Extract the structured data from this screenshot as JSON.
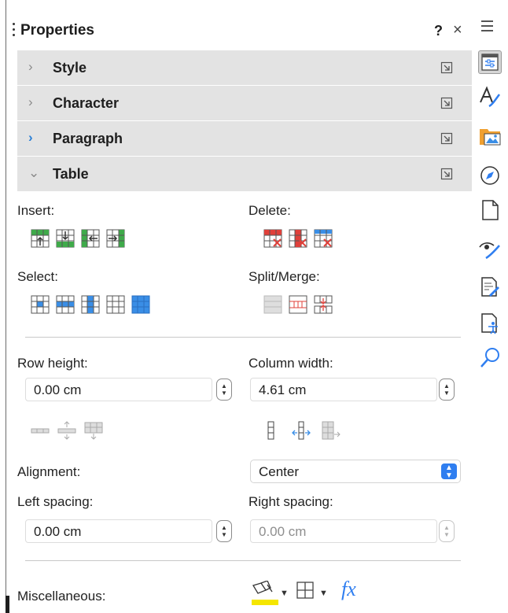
{
  "window": {
    "title": "Properties",
    "help_label": "?",
    "close_label": "×"
  },
  "sections": [
    {
      "label": "Style",
      "state": "collapsed"
    },
    {
      "label": "Character",
      "state": "collapsed"
    },
    {
      "label": "Paragraph",
      "state": "collapsed-active"
    },
    {
      "label": "Table",
      "state": "expanded"
    }
  ],
  "table": {
    "insert_label": "Insert:",
    "delete_label": "Delete:",
    "select_label": "Select:",
    "split_merge_label": "Split/Merge:",
    "insert_icons": [
      "insert-rows-above-icon",
      "insert-rows-below-icon",
      "insert-columns-before-icon",
      "insert-columns-after-icon"
    ],
    "delete_icons": [
      "delete-rows-icon",
      "delete-columns-icon",
      "delete-table-icon"
    ],
    "select_icons": [
      "select-cell-icon",
      "select-row-icon",
      "select-column-icon",
      "select-table-plain-icon",
      "select-table-icon"
    ],
    "split_merge_icons": [
      "merge-cells-icon",
      "split-cells-icon",
      "split-table-icon"
    ],
    "row_height_label": "Row height:",
    "row_height_value": "0.00 cm",
    "column_width_label": "Column width:",
    "column_width_value": "4.61 cm",
    "row_size_icons": [
      "minimal-row-height-icon",
      "optimal-row-height-icon",
      "distribute-rows-icon"
    ],
    "column_size_icons": [
      "minimal-column-width-icon",
      "optimal-column-width-icon",
      "distribute-columns-icon"
    ],
    "alignment_label": "Alignment:",
    "alignment_value": "Center",
    "left_spacing_label": "Left spacing:",
    "left_spacing_value": "0.00 cm",
    "right_spacing_label": "Right spacing:",
    "right_spacing_value": "0.00 cm",
    "misc_label": "Miscellaneous:",
    "formula_label": "fx"
  },
  "tabbar": {
    "items": [
      "properties-icon",
      "styles-icon",
      "gallery-icon",
      "navigator-icon",
      "page-icon",
      "style-inspector-icon",
      "manage-changes-icon",
      "accessibility-check-icon",
      "find-icon"
    ],
    "selected": "properties-icon"
  },
  "colors": {
    "section_bg": "#e3e3e3",
    "accent_blue": "#2f7ef0",
    "insert_green": "#3faa4a",
    "delete_red": "#e0403a",
    "select_blue": "#3a8ee6",
    "highlight_yellow": "#f5e600"
  }
}
